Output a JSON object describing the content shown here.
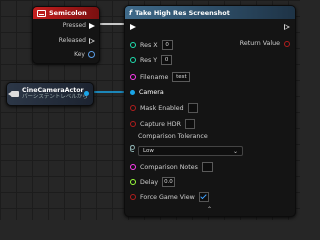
{
  "keyboard_node": {
    "title": "Semicolon",
    "outputs": [
      {
        "label": "Pressed"
      },
      {
        "label": "Released"
      },
      {
        "label": "Key"
      }
    ]
  },
  "actor_node": {
    "title": "CineCameraActor",
    "subtitle": "パーシステントレベルから"
  },
  "function_node": {
    "title": "Take High Res Screenshot",
    "return_label": "Return Value",
    "res_x": {
      "label": "Res X",
      "value": "0"
    },
    "res_y": {
      "label": "Res Y",
      "value": "0"
    },
    "filename": {
      "label": "Filename",
      "value": "test"
    },
    "camera": {
      "label": "Camera"
    },
    "mask_enabled": {
      "label": "Mask Enabled",
      "checked": false
    },
    "capture_hdr": {
      "label": "Capture HDR",
      "checked": false
    },
    "comparison_tolerance": {
      "label": "Comparison Tolerance",
      "selected": "Low"
    },
    "comparison_notes": {
      "label": "Comparison Notes",
      "value": ""
    },
    "delay": {
      "label": "Delay",
      "value": "0.0"
    },
    "force_game_view": {
      "label": "Force Game View",
      "checked": true
    }
  },
  "colors": {
    "exec_wire": "#ffffff",
    "object_wire": "#19a5e8",
    "int_pin": "#1fe0b0",
    "string_pin": "#ff3cf0",
    "bool_pin": "#b21e1e",
    "float_pin": "#9bff3c"
  }
}
